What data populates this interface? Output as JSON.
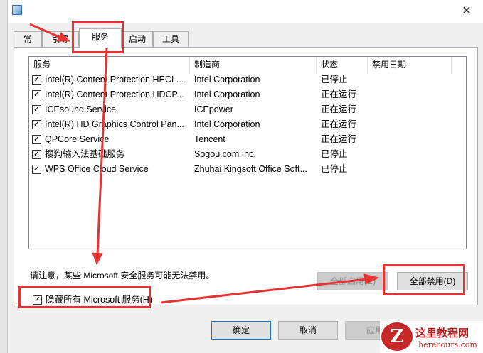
{
  "window": {
    "close_glyph": "✕",
    "app_icon": "msconfig-icon"
  },
  "tabs": [
    {
      "label": "常规",
      "active": false
    },
    {
      "label": "引导",
      "active": false
    },
    {
      "label": "服务",
      "active": true
    },
    {
      "label": "启动",
      "active": false
    },
    {
      "label": "工具",
      "active": false
    }
  ],
  "columns": [
    "服务",
    "制造商",
    "状态",
    "禁用日期"
  ],
  "services": [
    {
      "checked": true,
      "name": "Intel(R) Content Protection HECI ...",
      "vendor": "Intel Corporation",
      "status": "已停止",
      "date": ""
    },
    {
      "checked": true,
      "name": "Intel(R) Content Protection HDCP...",
      "vendor": "Intel Corporation",
      "status": "正在运行",
      "date": ""
    },
    {
      "checked": true,
      "name": "ICEsound Service",
      "vendor": "ICEpower",
      "status": "正在运行",
      "date": ""
    },
    {
      "checked": true,
      "name": "Intel(R) HD Graphics Control Pan...",
      "vendor": "Intel Corporation",
      "status": "正在运行",
      "date": ""
    },
    {
      "checked": true,
      "name": "QPCore Service",
      "vendor": "Tencent",
      "status": "正在运行",
      "date": ""
    },
    {
      "checked": true,
      "name": "搜狗输入法基础服务",
      "vendor": "Sogou.com Inc.",
      "status": "已停止",
      "date": ""
    },
    {
      "checked": true,
      "name": "WPS Office Cloud Service",
      "vendor": "Zhuhai Kingsoft Office Soft...",
      "status": "已停止",
      "date": ""
    }
  ],
  "note": "请注意，某些 Microsoft 安全服务可能无法禁用。",
  "buttons": {
    "enable_all": "全部启用(E)",
    "disable_all": "全部禁用(D)",
    "ok": "确定",
    "cancel": "取消",
    "apply": "应用"
  },
  "hide_ms": {
    "label": "隐藏所有 Microsoft 服务(H)",
    "checked": true
  },
  "check_glyph": "✓",
  "annotation_color": "#e53333",
  "watermark": {
    "logo_letter": "Z",
    "title": "这里教程网",
    "subtitle": "herecours.com"
  }
}
